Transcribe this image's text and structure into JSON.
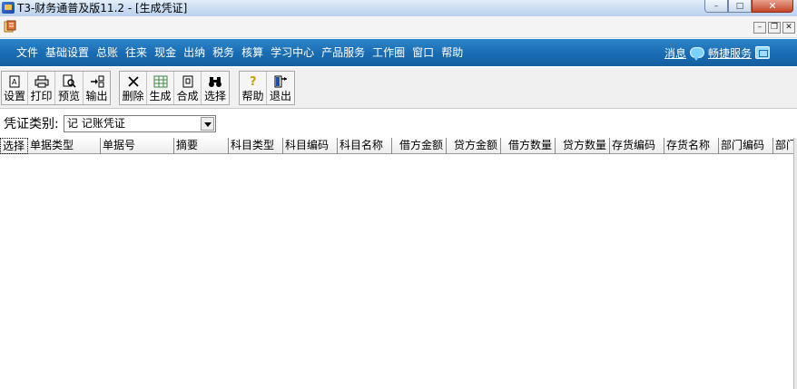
{
  "window": {
    "title": "T3-财务通普及版11.2 - [生成凭证]",
    "minimize_glyph": "–",
    "maximize_glyph": "□",
    "close_glyph": "✕"
  },
  "mdi": {
    "minimize_glyph": "–",
    "restore_glyph": "❐",
    "close_glyph": "✕"
  },
  "menu": {
    "items": [
      "文件",
      "基础设置",
      "总账",
      "往来",
      "现金",
      "出纳",
      "税务",
      "核算",
      "学习中心",
      "产品服务",
      "工作圈",
      "窗口",
      "帮助"
    ],
    "message_link": "消息",
    "service_link": "畅捷服务"
  },
  "toolbar": {
    "setup": "设置",
    "print": "打印",
    "preview": "预览",
    "export": "输出",
    "delete": "删除",
    "generate": "生成",
    "merge": "合成",
    "select": "选择",
    "help": "帮助",
    "exit": "退出"
  },
  "filter": {
    "label": "凭证类别:",
    "value": "记 记账凭证"
  },
  "grid": {
    "columns": [
      "选择",
      "单据类型",
      "单据号",
      "摘要",
      "科目类型",
      "科目编码",
      "科目名称",
      "借方金额",
      "贷方金额",
      "借方数量",
      "贷方数量",
      "存货编码",
      "存货名称",
      "部门编码",
      "部门"
    ]
  },
  "colors": {
    "menubar": "#1a6db3",
    "titlebar": "#cddff3",
    "toolbar": "#f0f0f0"
  }
}
